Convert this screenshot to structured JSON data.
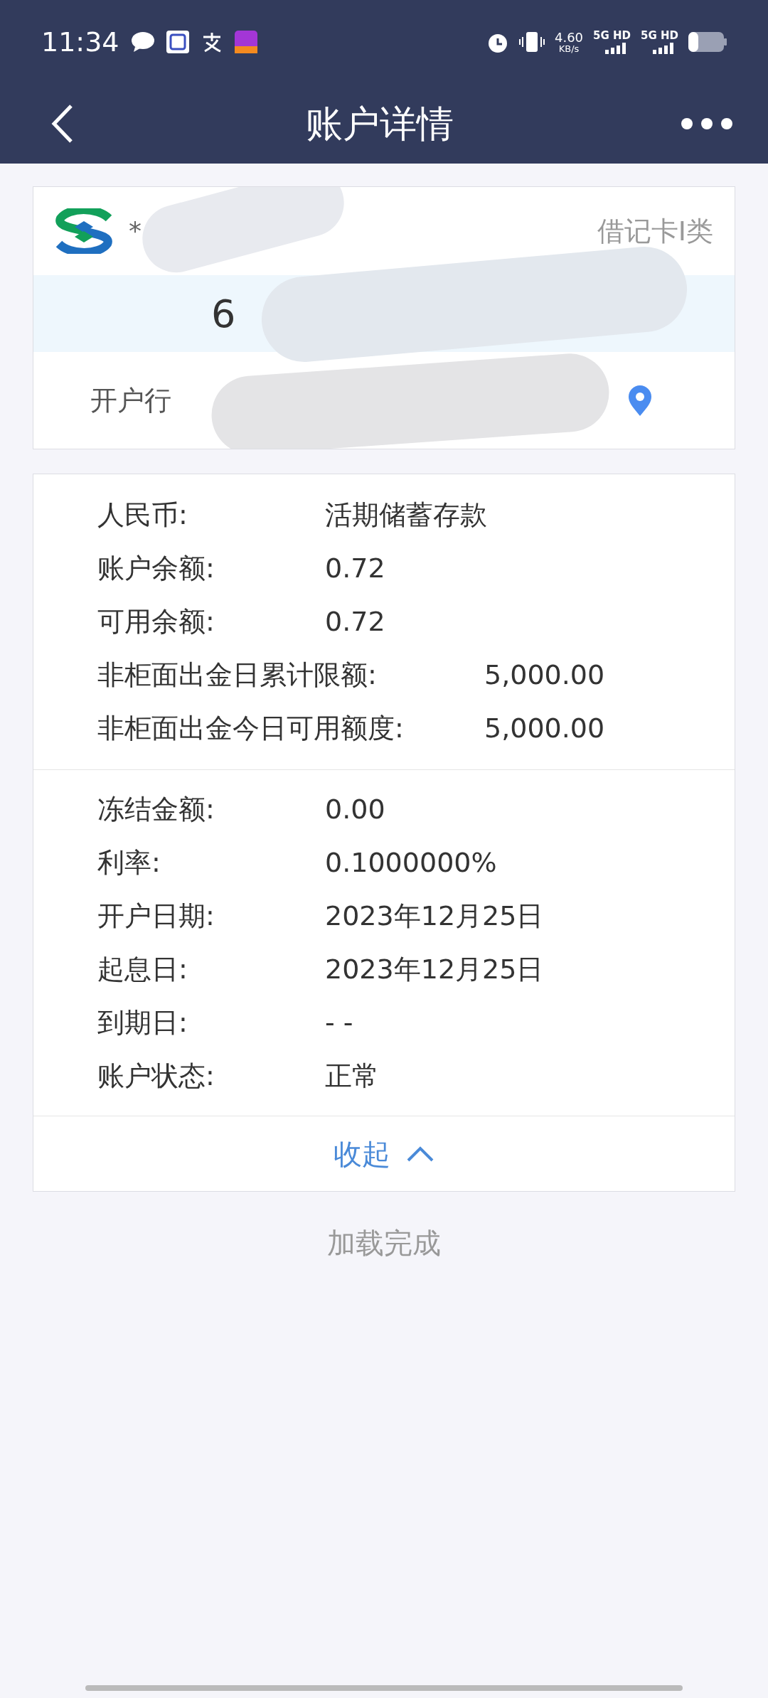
{
  "status_bar": {
    "time": "11:34",
    "net_speed": "4.60",
    "net_unit": "KB/s",
    "sim1": "5G HD",
    "sim2": "5G HD"
  },
  "header": {
    "title": "账户详情"
  },
  "card": {
    "holder": "*",
    "card_type": "借记卡I类",
    "number": "6",
    "branch_label": "开户行"
  },
  "details": [
    {
      "label": "人民币:",
      "value": "活期储蓄存款"
    },
    {
      "label": "账户余额:",
      "value": "0.72"
    },
    {
      "label": "可用余额:",
      "value": "0.72"
    }
  ],
  "limits": [
    {
      "label": "非柜面出金日累计限额:",
      "value": "5,000.00"
    },
    {
      "label": "非柜面出金今日可用额度:",
      "value": "5,000.00"
    }
  ],
  "more_details": [
    {
      "label": "冻结金额:",
      "value": "0.00"
    },
    {
      "label": "利率:",
      "value": "0.1000000%"
    },
    {
      "label": "开户日期:",
      "value": "2023年12月25日"
    },
    {
      "label": "起息日:",
      "value": "2023年12月25日"
    },
    {
      "label": "到期日:",
      "value": "- -"
    },
    {
      "label": "账户状态:",
      "value": "正常"
    }
  ],
  "collapse": {
    "label": "收起",
    "expanded": true
  },
  "footer": {
    "text": "加载完成"
  }
}
